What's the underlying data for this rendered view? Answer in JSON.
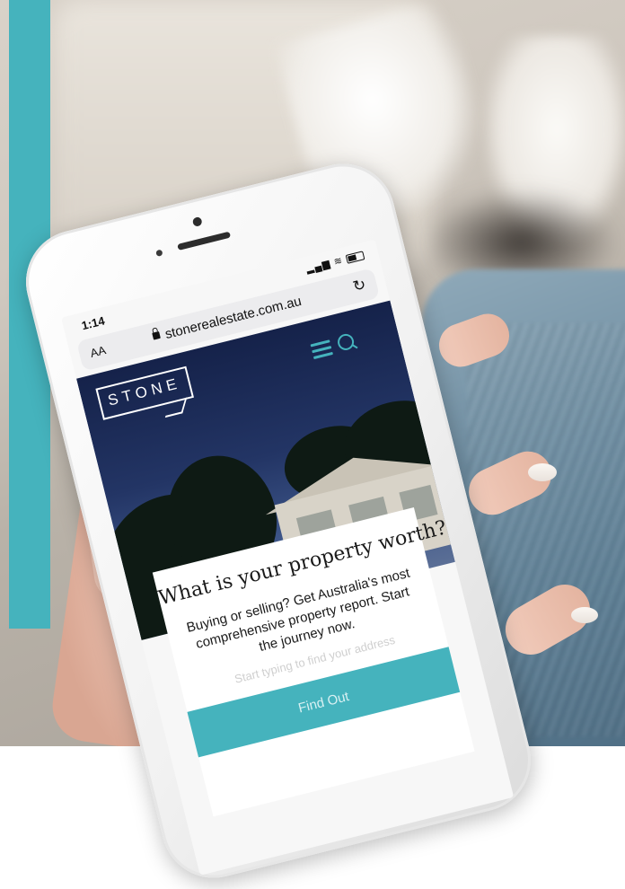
{
  "status_bar": {
    "time": "1:14",
    "signal_icon": "signal-icon",
    "wifi_icon": "wifi-icon",
    "battery_icon": "battery-icon"
  },
  "browser": {
    "text_size_label": "AA",
    "url": "stonerealestate.com.au",
    "lock_icon": "lock-icon",
    "reload_icon": "reload-icon"
  },
  "site": {
    "logo_text": "STONE",
    "menu_icon": "hamburger-icon",
    "search_icon": "search-icon",
    "hero": {
      "title": "What is your property worth?",
      "subtitle_lines": [
        "Buying or selling? Get Australia's most",
        "comprehensive property report. Start",
        "the journey now."
      ],
      "address_placeholder": "Start typing to find your address",
      "cta_label": "Find Out"
    }
  },
  "colors": {
    "accent": "#45b3bd",
    "hero_sky": "#233565"
  }
}
